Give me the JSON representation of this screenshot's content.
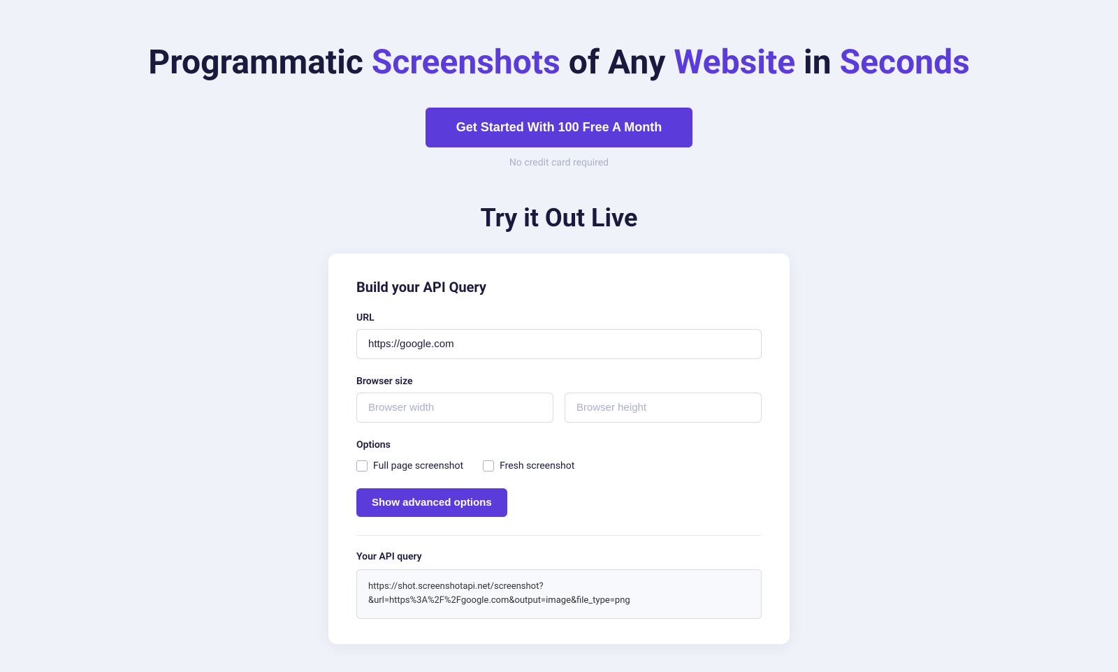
{
  "hero": {
    "title_prefix": "Programmatic ",
    "title_highlight1": "Screenshots",
    "title_middle": " of Any ",
    "title_highlight2": "Website",
    "title_suffix": " in ",
    "title_highlight3": "Seconds"
  },
  "cta": {
    "button_label": "Get Started With 100 Free A Month",
    "subtitle": "No credit card required"
  },
  "try_section": {
    "title": "Try it Out Live"
  },
  "card": {
    "title": "Build your API Query",
    "url_label": "URL",
    "url_placeholder": "https://google.com",
    "url_value": "https://google.com",
    "browser_size_label": "Browser size",
    "browser_width_placeholder": "Browser width",
    "browser_height_placeholder": "Browser height",
    "options_label": "Options",
    "full_page_label": "Full page screenshot",
    "fresh_screenshot_label": "Fresh screenshot",
    "advanced_btn_label": "Show advanced options",
    "api_query_label": "Your API query",
    "api_query_value": "https://shot.screenshotapi.net/screenshot?\n&url=https%3A%2F%2Fgoogle.com&output=image&file_type=png"
  }
}
